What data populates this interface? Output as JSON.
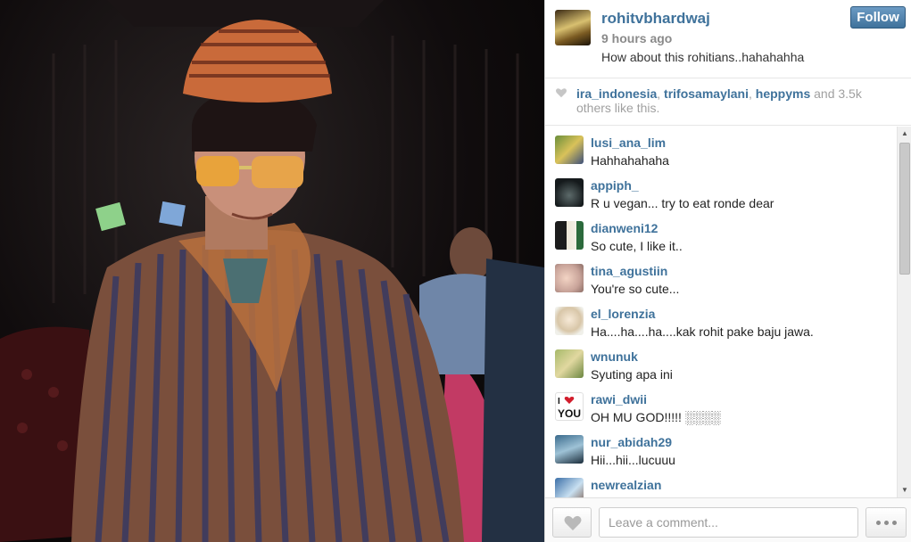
{
  "photo": {
    "alt_subject": "man-in-striped-robe-and-sunglasses"
  },
  "post": {
    "owner": "rohitvbhardwaj",
    "time_ago": "9 hours ago",
    "caption": "How about this rohitians..hahahahha",
    "follow_label": "Follow"
  },
  "likes": {
    "likers": [
      "ira_indonesia",
      "trifosamaylani",
      "heppyms"
    ],
    "sep1": ", ",
    "sep2": ", ",
    "and_text": " and ",
    "count": "3.5k",
    "tail_text": "others like this."
  },
  "comments": [
    {
      "user": "lusi_ana_lim",
      "text": "Hahhahahaha"
    },
    {
      "user": "appiph_",
      "text": "R u vegan... try to eat ronde dear"
    },
    {
      "user": "dianweni12",
      "text": "So cute, I like it.."
    },
    {
      "user": "tina_agustiin",
      "text": "You're so cute..."
    },
    {
      "user": "el_lorenzia",
      "text": "Ha....ha....ha....kak rohit pake baju jawa."
    },
    {
      "user": "wnunuk",
      "text": "Syuting apa ini"
    },
    {
      "user": "rawi_dwii",
      "text": "OH MU GOD!!!!! ░░░░"
    },
    {
      "user": "nur_abidah29",
      "text": "Hii...hii...lucuuu"
    },
    {
      "user": "newrealzian",
      "text": ""
    }
  ],
  "footer": {
    "comment_placeholder": "Leave a comment..."
  },
  "colors": {
    "link": "#3f729b",
    "muted": "#a0a0a0",
    "follow": "#3f729b"
  },
  "icons": {
    "like": "heart-icon",
    "more": "ellipsis-icon",
    "scroll_up": "arrow-up-icon",
    "scroll_down": "arrow-down-icon"
  }
}
